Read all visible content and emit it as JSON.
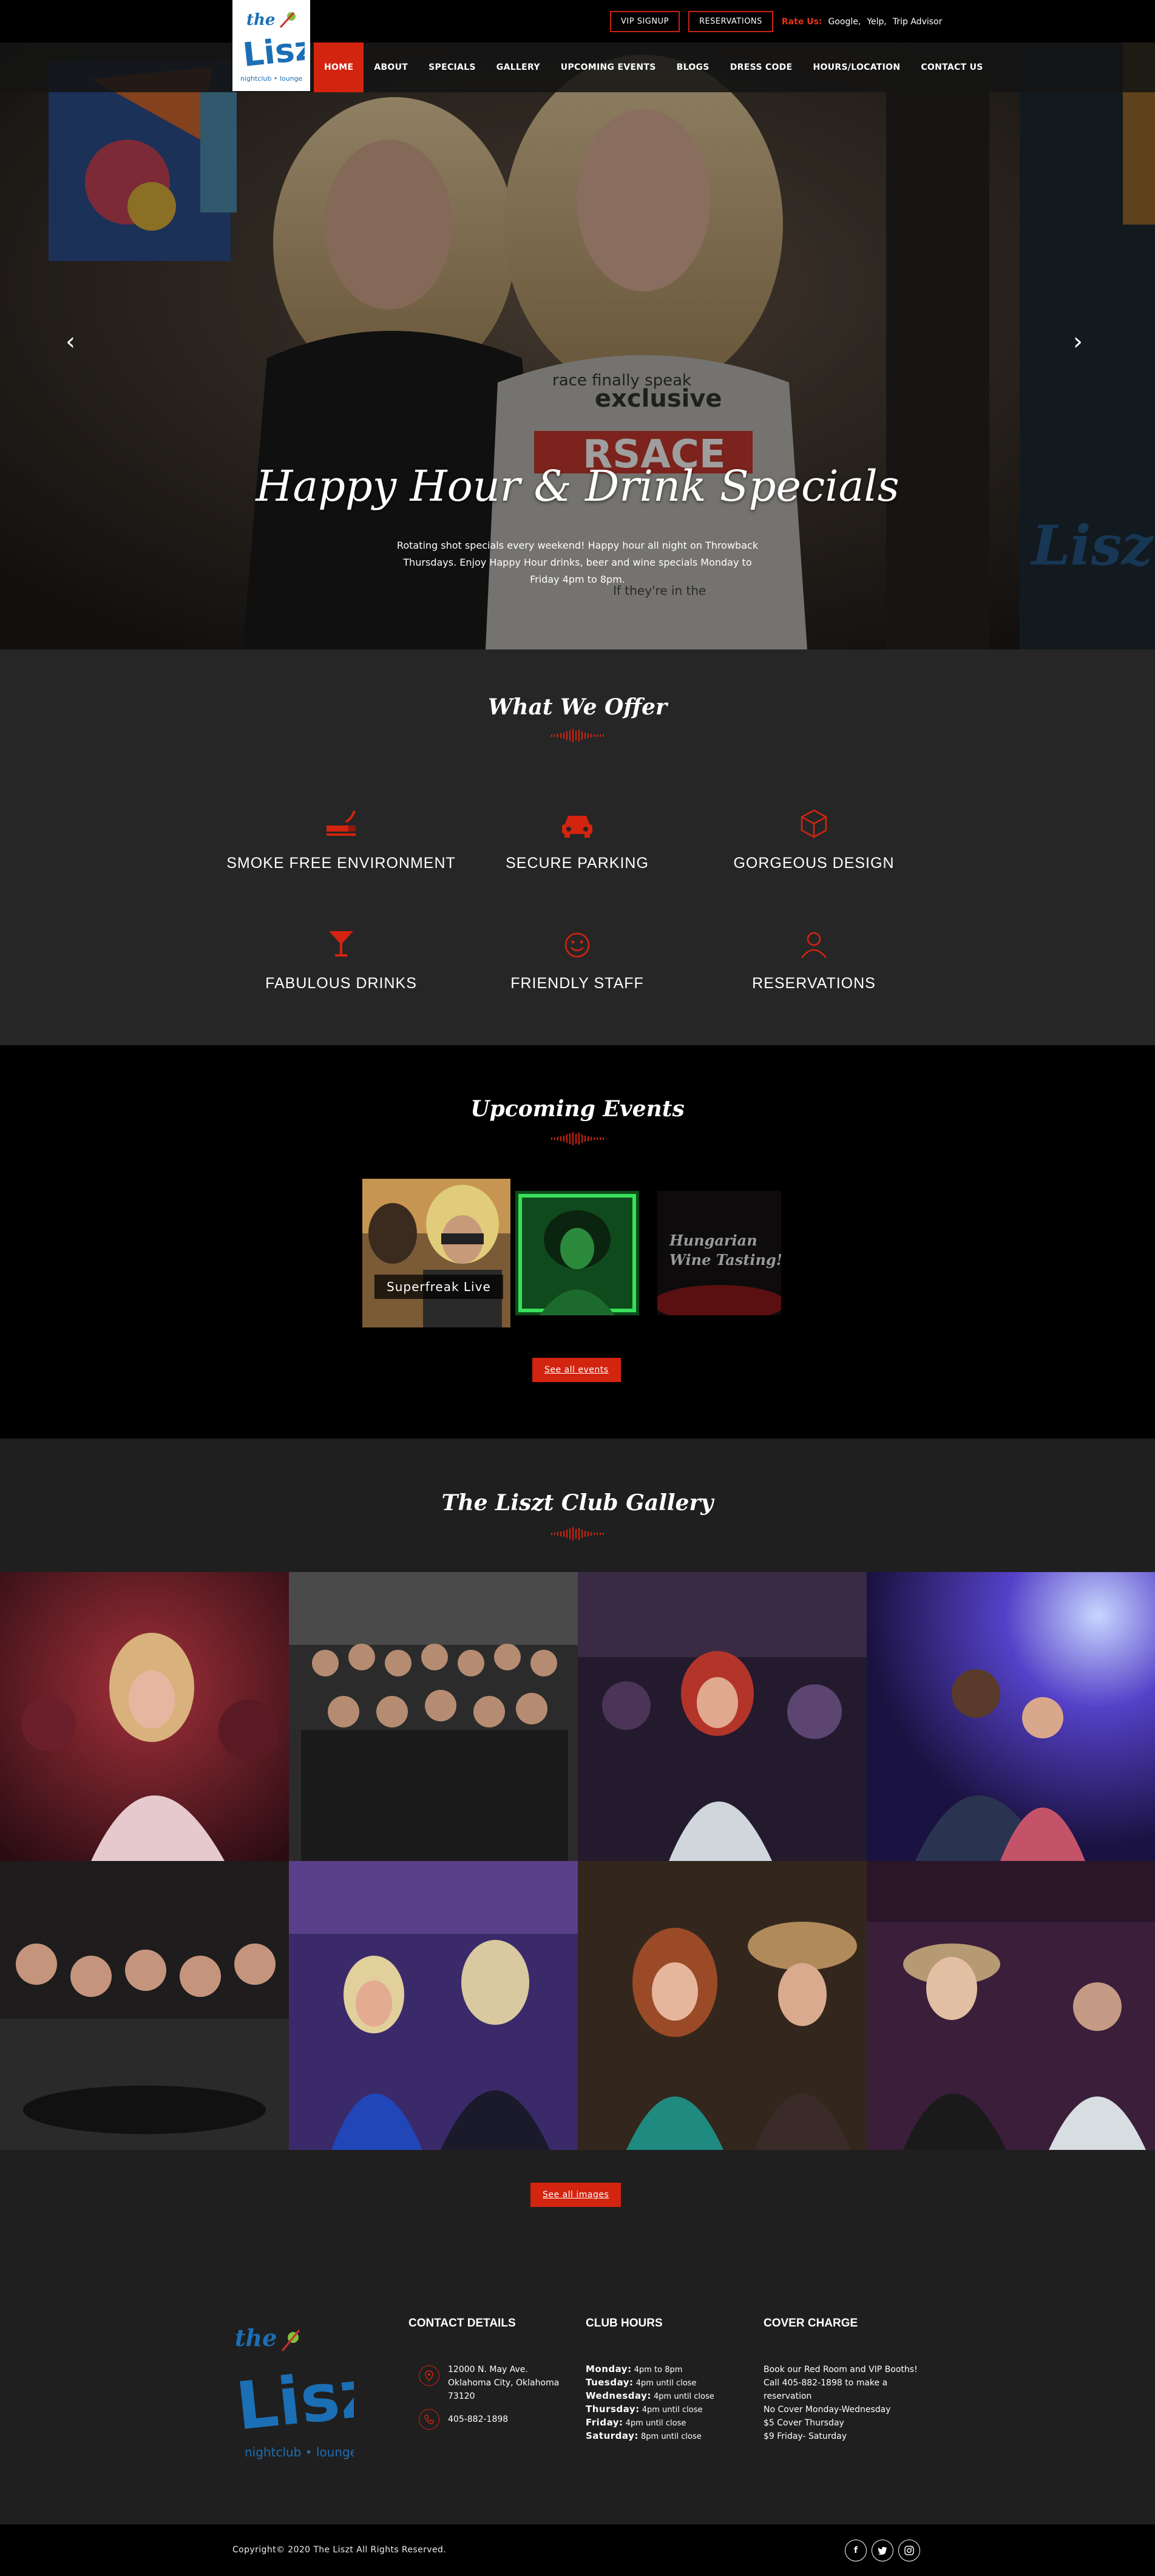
{
  "topbar": {
    "vip_signup": "VIP SIGNUP",
    "reservations": "RESERVATIONS",
    "rate_label": "Rate Us:",
    "rate_links": [
      "Google,",
      "Yelp,",
      "Trip Advisor"
    ]
  },
  "logo": {
    "line1": "the",
    "line2": "Liszt",
    "line3": "nightclub • lounge"
  },
  "nav": [
    "HOME",
    "ABOUT",
    "SPECIALS",
    "GALLERY",
    "UPCOMING EVENTS",
    "BLOGS",
    "DRESS CODE",
    "HOURS/LOCATION",
    "CONTACT US"
  ],
  "hero": {
    "title": "Happy Hour & Drink Specials",
    "text": "Rotating shot specials every weekend! Happy hour all night on Throwback Thursdays. Enjoy Happy Hour drinks, beer and wine specials Monday to Friday 4pm to 8pm.",
    "shirt_text": [
      "exclusive",
      "race finally speak",
      "RSACE",
      "If they're in the"
    ]
  },
  "offer": {
    "title": "What We Offer",
    "features": [
      {
        "label": "SMOKE FREE ENVIRONMENT",
        "icon": "no-smoking-icon"
      },
      {
        "label": "SECURE PARKING",
        "icon": "car-icon"
      },
      {
        "label": "GORGEOUS DESIGN",
        "icon": "cube-icon"
      },
      {
        "label": "FABULOUS DRINKS",
        "icon": "cocktail-icon"
      },
      {
        "label": "FRIENDLY STAFF",
        "icon": "smile-icon"
      },
      {
        "label": "RESERVATIONS",
        "icon": "user-icon"
      }
    ]
  },
  "events": {
    "title": "Upcoming Events",
    "items": [
      {
        "label": "Superfreak Live"
      },
      {
        "label": ""
      },
      {
        "label": "Hungarian Wine Tasting!"
      }
    ],
    "see_all": "See all events"
  },
  "gallery": {
    "title": "The Liszt Club Gallery",
    "see_all": "See all images"
  },
  "footer": {
    "contact": {
      "title": "CONTACT DETAILS",
      "address": "12000 N. May Ave. Oklahoma City, Oklahoma 73120",
      "phone": "405-882-1898"
    },
    "hours": {
      "title": "CLUB HOURS",
      "rows": [
        {
          "day": "Monday:",
          "time": "4pm to 8pm"
        },
        {
          "day": "Tuesday:",
          "time": "4pm until close"
        },
        {
          "day": "Wednesday:",
          "time": "4pm until close"
        },
        {
          "day": "Thursday:",
          "time": "4pm until close"
        },
        {
          "day": "Friday:",
          "time": "4pm until close"
        },
        {
          "day": "Saturday:",
          "time": "8pm until close"
        }
      ]
    },
    "cover": {
      "title": "COVER CHARGE",
      "lines": [
        "Book our Red Room and VIP Booths!",
        "Call 405-882-1898 to make a reservation",
        "No Cover Monday-Wednesday",
        "$5 Cover Thursday",
        "$9 Friday- Saturday"
      ]
    }
  },
  "copyright": "Copyright© 2020 The Liszt All Rights Reserved.",
  "social": [
    "f",
    "t",
    "o"
  ],
  "colors": {
    "accent": "#d3240f",
    "logo_blue": "#1b6fb5",
    "dark_bg": "#262626"
  }
}
